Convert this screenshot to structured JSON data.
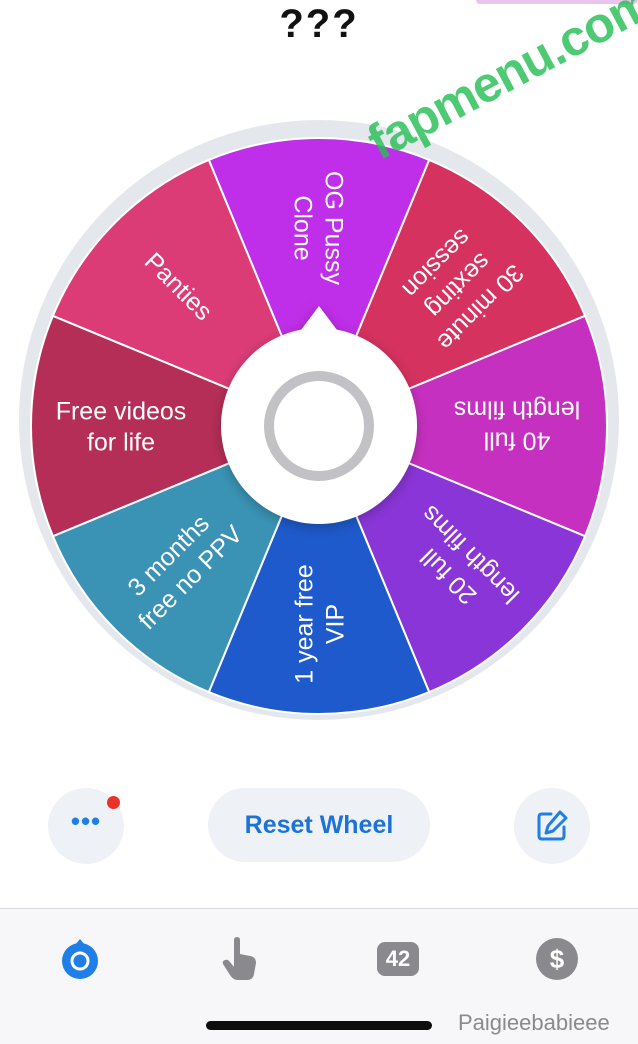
{
  "page": {
    "title": "???"
  },
  "wheel": {
    "segments": [
      {
        "label": "OG Pussy Clone",
        "color": "#bf2ee8"
      },
      {
        "label": "30 minute sexting session",
        "color": "#d5325f"
      },
      {
        "label": "40 full length films",
        "color": "#c630c0"
      },
      {
        "label": "20 full length films",
        "color": "#8a35d8"
      },
      {
        "label": "1 year free VIP",
        "color": "#1e5acb"
      },
      {
        "label": "3 months free no PPV",
        "color": "#3a93b5"
      },
      {
        "label": "Free videos for life",
        "color": "#b52e58"
      },
      {
        "label": "Panties",
        "color": "#dc3c76"
      }
    ]
  },
  "watermark": {
    "text": "fapmenu.com"
  },
  "actions": {
    "more_label": "•••",
    "reset_label": "Reset Wheel"
  },
  "tabbar": {
    "badge_count": "42",
    "dollar_label": "$",
    "active_color": "#1f7fe6"
  },
  "username": "Paigieebabieee"
}
